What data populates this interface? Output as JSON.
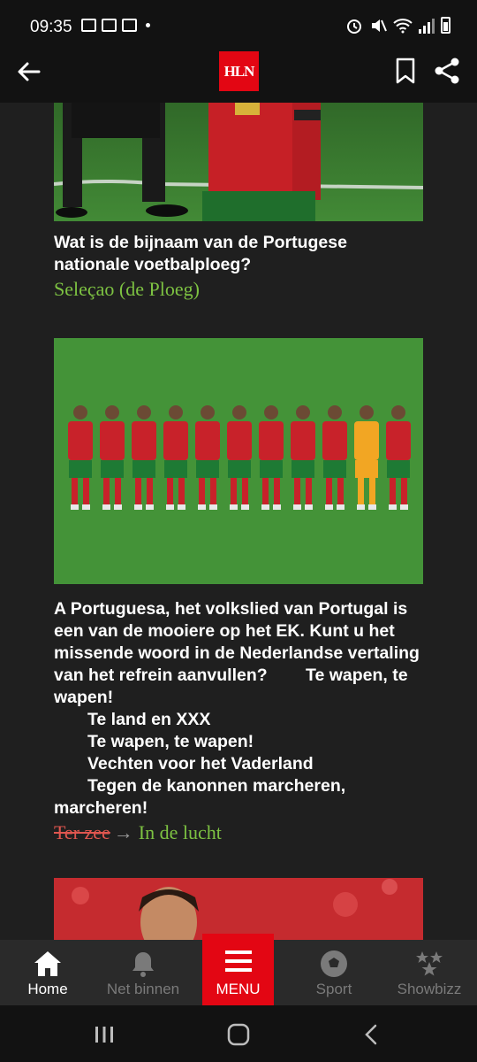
{
  "status_bar": {
    "time": "09:35"
  },
  "app_bar": {
    "logo_text": "HLN"
  },
  "articles": [
    {
      "question": "Wat is de bijnaam van de Portugese nationale voetbalploeg?",
      "answer": "Seleçao (de Ploeg)"
    },
    {
      "question": "A Portuguesa, het volkslied van Portugal is een van de mooiere op het EK. Kunt u het missende woord in de Nederlandse vertaling van het refrein aanvullen?        Te wapen, te wapen!\n       Te land en XXX\n       Te wapen, te wapen!\n       Vechten voor het Vaderland\n       Tegen de kanonnen marcheren, marcheren!",
      "wrong_answer": "Ter zee",
      "correct_answer": "In de lucht"
    }
  ],
  "bottom_nav": {
    "items": [
      {
        "label": "Home",
        "icon": "home-icon",
        "active": true
      },
      {
        "label": "Net binnen",
        "icon": "bell-icon",
        "active": false
      },
      {
        "label": "MENU",
        "icon": "hamburger-menu-icon",
        "active": false
      },
      {
        "label": "Sport",
        "icon": "soccer-ball-icon",
        "active": false
      },
      {
        "label": "Showbizz",
        "icon": "stars-icon",
        "active": false
      }
    ]
  },
  "colors": {
    "brand_red": "#e30613",
    "correct_green": "#7dc242",
    "wrong_red": "#e0564f",
    "background": "#1f1f1f"
  }
}
